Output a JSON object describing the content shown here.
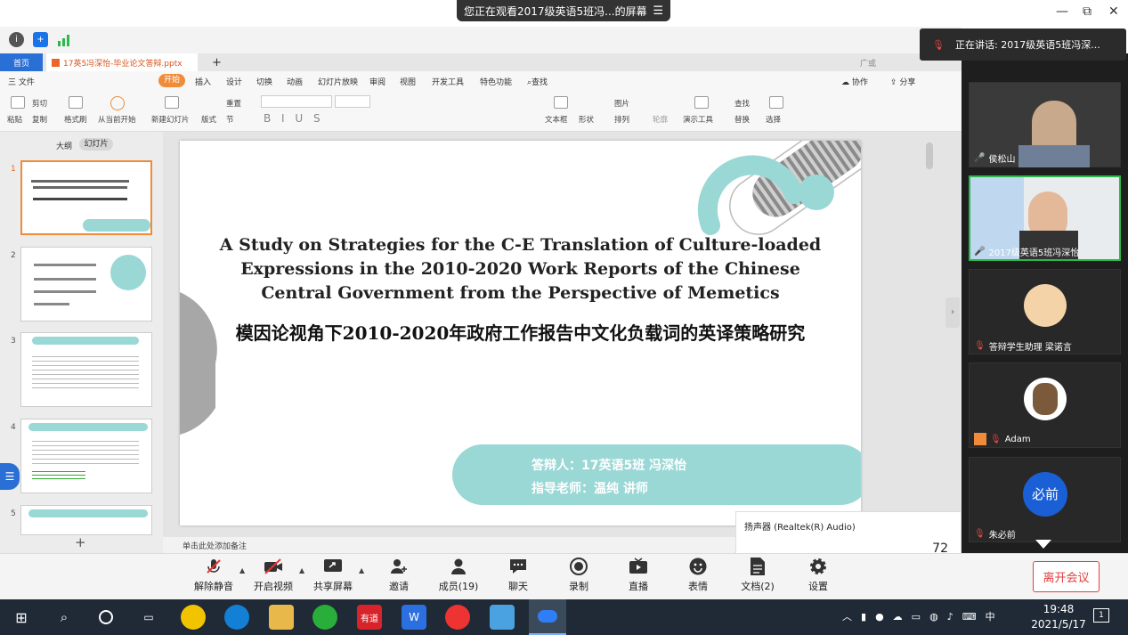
{
  "banner": {
    "text": "您正在观看2017级英语5班冯...的屏幕",
    "menu": "☰"
  },
  "window": {
    "minimize": "—",
    "restore": "⧉",
    "close": "✕"
  },
  "wps": {
    "home_tab": "首页",
    "doc_tab": "17英5冯深怡-毕业论文答辩.pptx",
    "new_tab": "+",
    "guangao": "广或",
    "file_menu": "三 文件",
    "menu_tabs": [
      "开始",
      "插入",
      "设计",
      "切换",
      "动画",
      "幻灯片放映",
      "审阅",
      "视图",
      "开发工具",
      "特色功能"
    ],
    "search": "查找",
    "collab": "协作",
    "share": "分享",
    "ribbon_labels": {
      "paste": "粘贴",
      "cut": "剪切",
      "copy": "复制",
      "format_painter": "格式刷",
      "from_current": "从当前开始",
      "new_slide": "新建幻灯片",
      "layout": "版式",
      "section": "节",
      "reset": "重置",
      "textbox": "文本框",
      "shape": "形状",
      "picture": "图片",
      "arrange": "排列",
      "outline": "轮廓",
      "slideshow_tool": "演示工具",
      "find": "查找",
      "replace": "替换",
      "select": "选择"
    },
    "left_tabs": {
      "outline": "大纲",
      "slides": "幻灯片"
    },
    "thumb_numbers": [
      "1",
      "2",
      "3",
      "4",
      "5"
    ],
    "notes_placeholder": "单击此处添加备注",
    "add_slide": "+"
  },
  "slide": {
    "title_lines": [
      "A Study on Strategies for the C-E Translation of Culture-loaded",
      "Expressions in the 2010-2020 Work Reports of the Chinese",
      "Central Government from the Perspective of Memetics"
    ],
    "cn_title": "模因论视角下2010-2020年政府工作报告中文化负载词的英译策略研究",
    "presenter": "答辩人：17英语5班 冯深怡",
    "advisor": "指导老师：温纯 讲师",
    "colors": {
      "teal": "#9ad8d6",
      "gray": "#a7a7a7"
    }
  },
  "audio": {
    "device": "扬声器 (Realtek(R) Audio)",
    "volume": "72"
  },
  "participants": {
    "speaking": "正在讲话: 2017级英语5班冯深...",
    "list": [
      {
        "name": "侯松山"
      },
      {
        "name": "2017级英语5班冯深怡"
      },
      {
        "name": "答辩学生助理 梁诺言"
      },
      {
        "name": "Adam"
      },
      {
        "name": "朱必前",
        "avatar_text": "必前"
      }
    ]
  },
  "toolbar": [
    {
      "label": "解除静音",
      "icon": "mic-off-icon"
    },
    {
      "label": "开启视频",
      "icon": "camera-off-icon"
    },
    {
      "label": "共享屏幕",
      "icon": "share-screen-icon"
    },
    {
      "label": "邀请",
      "icon": "invite-icon"
    },
    {
      "label": "成员(19)",
      "icon": "members-icon"
    },
    {
      "label": "聊天",
      "icon": "chat-icon"
    },
    {
      "label": "录制",
      "icon": "record-icon"
    },
    {
      "label": "直播",
      "icon": "live-icon"
    },
    {
      "label": "表情",
      "icon": "emoji-icon"
    },
    {
      "label": "文档(2)",
      "icon": "document-icon"
    },
    {
      "label": "设置",
      "icon": "settings-icon"
    }
  ],
  "leave_button": "离开会议",
  "taskbar": {
    "apps": [
      "有道"
    ],
    "ime": "中",
    "time": "19:48",
    "date": "2021/5/17",
    "notification_count": "1"
  }
}
